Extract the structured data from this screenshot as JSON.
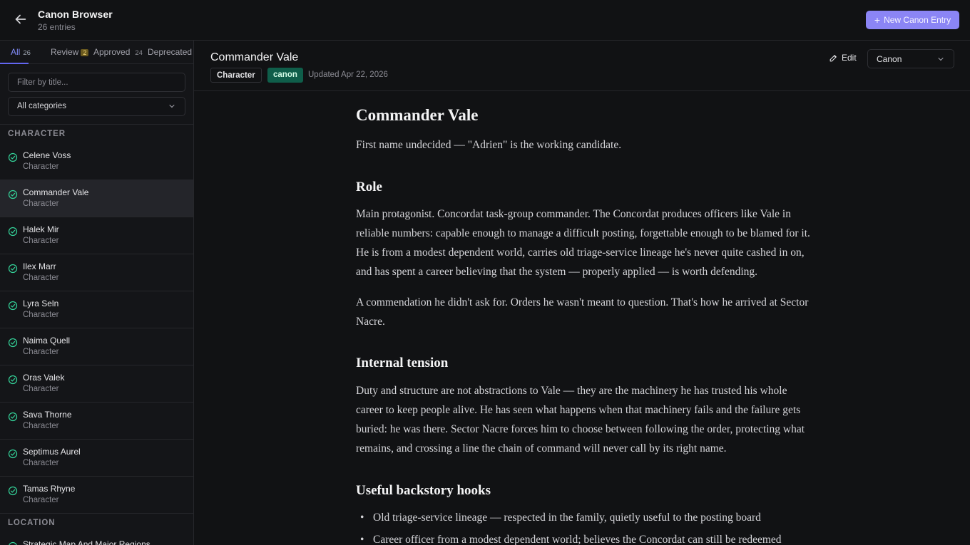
{
  "header": {
    "title": "Canon Browser",
    "subtitle": "26 entries",
    "new_button": "New Canon Entry"
  },
  "tabs": [
    {
      "label": "All",
      "count": "26"
    },
    {
      "label": "Review",
      "count": "2"
    },
    {
      "label": "Approved",
      "count": "24"
    },
    {
      "label": "Deprecated",
      "count": ""
    }
  ],
  "filter": {
    "placeholder": "Filter by title..."
  },
  "category_select": {
    "value": "All categories"
  },
  "sections": [
    {
      "label": "CHARACTER",
      "items": [
        {
          "name": "Celene Voss",
          "category": "Character"
        },
        {
          "name": "Commander Vale",
          "category": "Character"
        },
        {
          "name": "Halek Mir",
          "category": "Character"
        },
        {
          "name": "Ilex Marr",
          "category": "Character"
        },
        {
          "name": "Lyra Seln",
          "category": "Character"
        },
        {
          "name": "Naima Quell",
          "category": "Character"
        },
        {
          "name": "Oras Valek",
          "category": "Character"
        },
        {
          "name": "Sava Thorne",
          "category": "Character"
        },
        {
          "name": "Septimus Aurel",
          "category": "Character"
        },
        {
          "name": "Tamas Rhyne",
          "category": "Character"
        }
      ]
    },
    {
      "label": "LOCATION",
      "items": [
        {
          "name": "Strategic Map And Major Regions",
          "category": ""
        }
      ]
    }
  ],
  "doc_header": {
    "title": "Commander Vale",
    "type_tag": "Character",
    "status_tag": "canon",
    "updated": "Updated Apr 22, 2026",
    "edit_label": "Edit",
    "status_select": "Canon"
  },
  "document": {
    "title": "Commander Vale",
    "intro": "First name undecided — \"Adrien\" is the working candidate.",
    "role_heading": "Role",
    "role_p1": "Main protagonist. Concordat task-group commander. The Concordat produces officers like Vale in reliable numbers: capable enough to manage a difficult posting, forgettable enough to be blamed for it. He is from a modest dependent world, carries old triage-service lineage he's never quite cashed in on, and has spent a career believing that the system — properly applied — is worth defending.",
    "role_p2": "A commendation he didn't ask for. Orders he wasn't meant to question. That's how he arrived at Sector Nacre.",
    "tension_heading": "Internal tension",
    "tension_p1": "Duty and structure are not abstractions to Vale — they are the machinery he has trusted his whole career to keep people alive. He has seen what happens when that machinery fails and the failure gets buried: he was there. Sector Nacre forces him to choose between following the order, protecting what remains, and crossing a line the chain of command will never call by its right name.",
    "hooks_heading": "Useful backstory hooks",
    "hooks": [
      "Old triage-service lineage — respected in the family, quietly useful to the posting board",
      "Career officer from a modest dependent world; believes the Concordat can still be redeemed"
    ]
  }
}
